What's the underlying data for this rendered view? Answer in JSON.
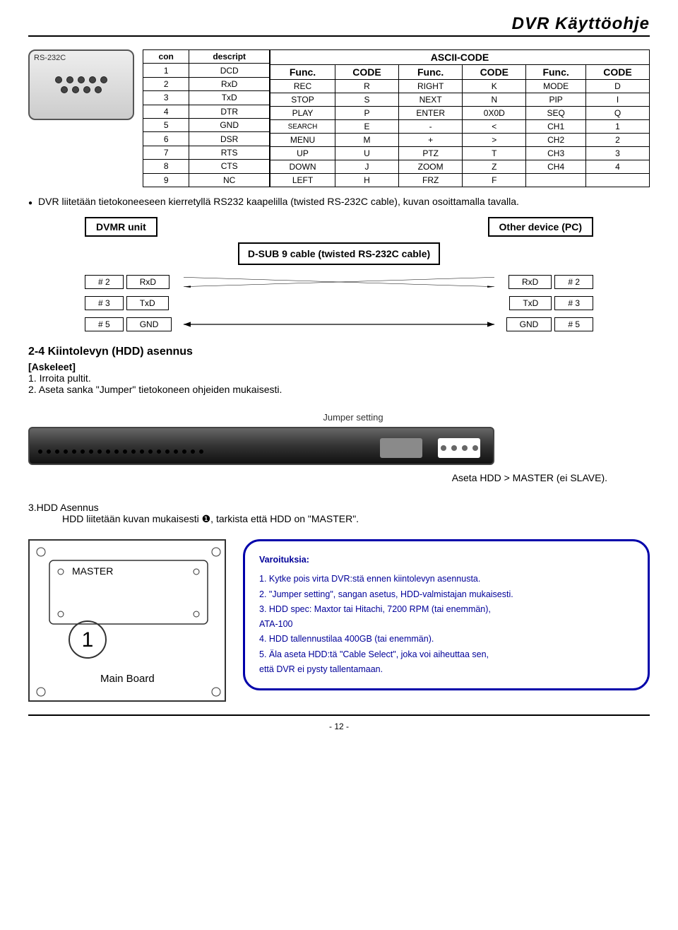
{
  "doc_title": "DVR  Käyttöohje",
  "connector_label": "RS-232C",
  "conn_table": {
    "headers": [
      "con",
      "descript"
    ],
    "rows": [
      [
        "1",
        "DCD"
      ],
      [
        "2",
        "RxD"
      ],
      [
        "3",
        "TxD"
      ],
      [
        "4",
        "DTR"
      ],
      [
        "5",
        "GND"
      ],
      [
        "6",
        "DSR"
      ],
      [
        "7",
        "RTS"
      ],
      [
        "8",
        "CTS"
      ],
      [
        "9",
        "NC"
      ]
    ]
  },
  "ascii_table": {
    "header": "ASCII-CODE",
    "subheaders": [
      "Func.",
      "CODE",
      "Func.",
      "CODE",
      "Func.",
      "CODE"
    ],
    "rows": [
      [
        "REC",
        "R",
        "RIGHT",
        "K",
        "MODE",
        "D"
      ],
      [
        "STOP",
        "S",
        "NEXT",
        "N",
        "PIP",
        "I"
      ],
      [
        "PLAY",
        "P",
        "ENTER",
        "0X0D",
        "SEQ",
        "Q"
      ],
      [
        "SEARCH",
        "E",
        "-",
        "<",
        "CH1",
        "1"
      ],
      [
        "MENU",
        "M",
        "+",
        ">",
        "CH2",
        "2"
      ],
      [
        "UP",
        "U",
        "PTZ",
        "T",
        "CH3",
        "3"
      ],
      [
        "DOWN",
        "J",
        "ZOOM",
        "Z",
        "CH4",
        "4"
      ],
      [
        "LEFT",
        "H",
        "FRZ",
        "F",
        "",
        ""
      ]
    ]
  },
  "bullet_text": "DVR liitetään tietokoneeseen kierretyllä RS232 kaapelilla (twisted RS-232C cable), kuvan osoittamalla tavalla.",
  "wire": {
    "left_box": "DVMR unit",
    "right_box": "Other device (PC)",
    "dsub_label": "D-SUB 9 cable (twisted RS-232C cable)",
    "pins": [
      {
        "lnum": "# 2",
        "lname": "RxD",
        "rname": "RxD",
        "rnum": "# 2"
      },
      {
        "lnum": "# 3",
        "lname": "TxD",
        "rname": "TxD",
        "rnum": "# 3"
      },
      {
        "lnum": "# 5",
        "lname": "GND",
        "rname": "GND",
        "rnum": "# 5"
      }
    ]
  },
  "section24_title": "2-4 Kiintolevyn (HDD) asennus",
  "section24_sub": "[Askeleet]",
  "steps12": [
    "1. Irroita pultit.",
    "2. Aseta sanka \"Jumper\" tietokoneen ohjeiden mukaisesti."
  ],
  "jumper_label": "Jumper setting",
  "master_note": "Aseta HDD > MASTER (ei SLAVE).",
  "step3_label": "3.HDD     Asennus",
  "step3_text": "HDD liitetään kuvan mukaisesti ❶, tarkista että HDD on \"MASTER\".",
  "board": {
    "master": "MASTER",
    "one": "1",
    "main": "Main Board"
  },
  "caution": {
    "title": "Varoituksia:",
    "items": [
      "1. Kytke pois virta DVR:stä ennen kiintolevyn asennusta.",
      "2. \"Jumper setting\", sangan asetus, HDD-valmistajan mukaisesti.",
      "3. HDD spec: Maxtor tai Hitachi, 7200 RPM (tai enemmän),",
      "ATA-100",
      "4. HDD tallennustilaa 400GB (tai enemmän).",
      "5. Äla aseta HDD:tä \"Cable Select\", joka voi aiheuttaa sen,",
      "että DVR ei pysty tallentamaan."
    ]
  },
  "page_num": "- 12 -"
}
